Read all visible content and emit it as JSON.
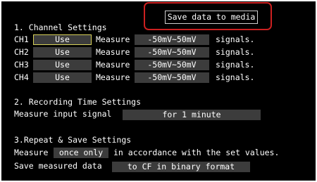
{
  "save_button": "Save data to media",
  "section1": {
    "title": "1. Channel Settings",
    "channels": [
      {
        "ch": "CH1",
        "use": "Use",
        "measure": "Measure",
        "range": "-50mV~50mV",
        "suffix": "signals."
      },
      {
        "ch": "CH2",
        "use": "Use",
        "measure": "Measure",
        "range": "-50mV~50mV",
        "suffix": "signals."
      },
      {
        "ch": "CH3",
        "use": "Use",
        "measure": "Measure",
        "range": "-50mV~50mV",
        "suffix": "signals."
      },
      {
        "ch": "CH4",
        "use": "Use",
        "measure": "Measure",
        "range": "-50mV~50mV",
        "suffix": "signals."
      }
    ]
  },
  "section2": {
    "title": "2. Recording Time Settings",
    "label": "Measure input signal",
    "value": "for 1 minute"
  },
  "section3": {
    "title": "3.Repeat & Save Settings",
    "line1_label": "Measure",
    "line1_value": "once only",
    "line1_suffix": "in accordance with the set values.",
    "line2_label": "Save measured data",
    "line2_value": "to CF in binary format"
  },
  "colors": {
    "background": "#000000",
    "field": "#3c3c3c",
    "selection": "#d8d25a",
    "highlight": "#cc2020"
  }
}
